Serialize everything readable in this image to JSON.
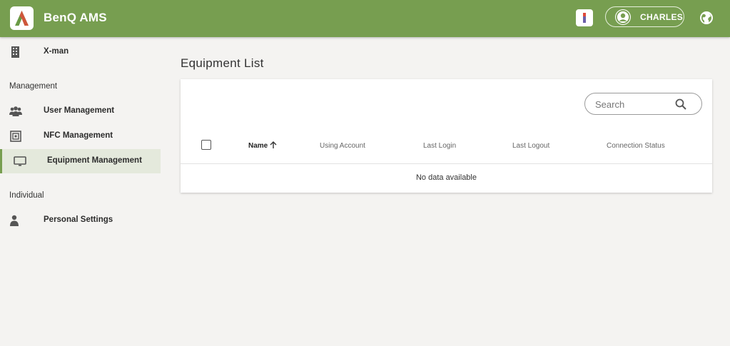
{
  "header": {
    "app_title": "BenQ AMS",
    "user_name": "CHARLES",
    "accent_color": "#779e50"
  },
  "sidebar": {
    "org_item": {
      "label": "X-man",
      "icon": "building-icon"
    },
    "sections": [
      {
        "label": "Management",
        "items": [
          {
            "label": "User Management",
            "icon": "users-icon"
          },
          {
            "label": "NFC Management",
            "icon": "nfc-card-icon"
          },
          {
            "label": "Equipment Management",
            "icon": "monitor-icon",
            "active": true
          }
        ]
      },
      {
        "label": "Individual",
        "items": [
          {
            "label": "Personal Settings",
            "icon": "person-icon"
          }
        ]
      }
    ]
  },
  "main": {
    "page_title": "Equipment List",
    "search": {
      "placeholder": "Search",
      "value": ""
    },
    "table": {
      "columns": [
        "Name",
        "Using Account",
        "Last Login",
        "Last Logout",
        "Connection Status"
      ],
      "sorted_column": "Name",
      "sort_direction": "ascending",
      "empty_message": "No data available"
    }
  }
}
